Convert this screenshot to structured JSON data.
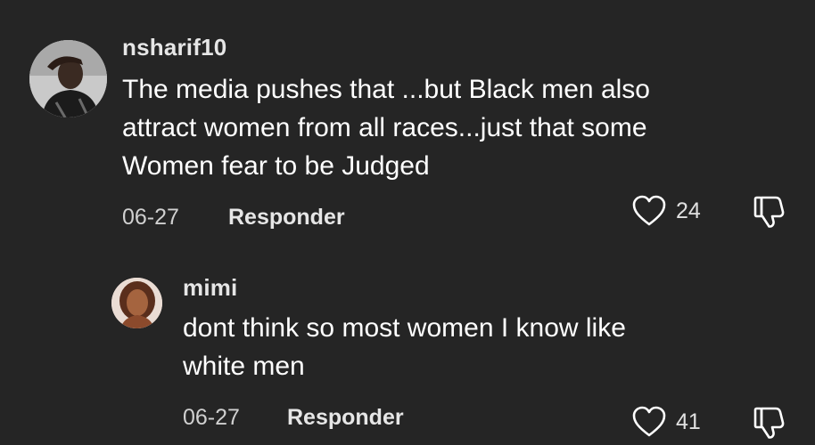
{
  "comments": [
    {
      "username": "nsharif10",
      "text": "The media pushes that ...but Black men also attract women from all races...just that some Women fear to be Judged",
      "lines": [
        "The media pushes that ...but Black men also",
        "attract women from all races...just that some",
        "Women fear to be Judged"
      ],
      "date": "06-27",
      "reply_label": "Responder",
      "likes": "24",
      "like_icon": "heart-outline-icon",
      "dislike_icon": "thumbs-down-icon"
    },
    {
      "username": "mimi",
      "text": "dont think so most women I know like white men",
      "lines": [
        "dont think so most women I know like",
        "white men"
      ],
      "date": "06-27",
      "reply_label": "Responder",
      "likes": "41",
      "like_icon": "heart-outline-icon",
      "dislike_icon": "thumbs-down-icon"
    }
  ],
  "colors": {
    "background": "#252525",
    "text": "#ffffff",
    "muted": "#d0d0d0"
  }
}
